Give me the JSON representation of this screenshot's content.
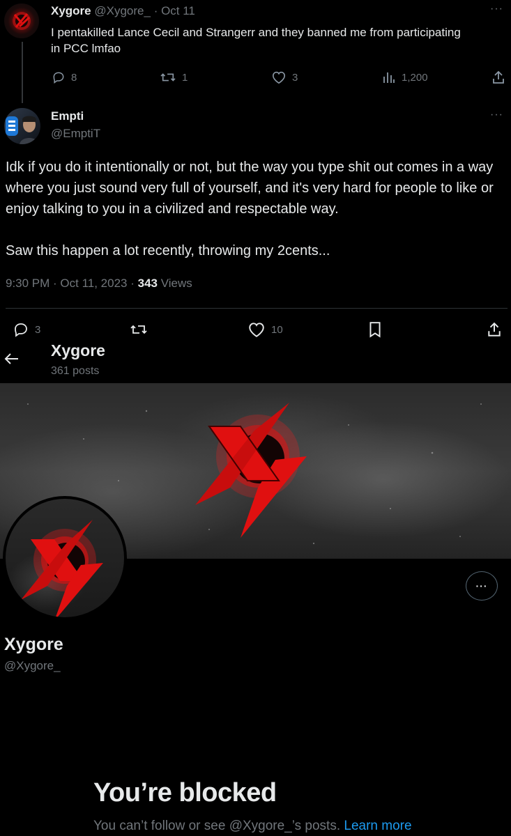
{
  "tweet1": {
    "name": "Xygore",
    "handle": "@Xygore_",
    "time": "· Oct 11",
    "text": "I pentakilled Lance Cecil and Strangerr and they banned me from participating in PCC lmfao",
    "replies": "8",
    "retweets": "1",
    "likes": "3",
    "views": "1,200",
    "more": "···"
  },
  "tweet2": {
    "name": "Empti",
    "handle": "@EmptiT",
    "more": "···",
    "paragraph1": "Idk if you do it intentionally or not, but the way you type shit out comes in a way where you just sound very full of yourself, and it's very hard for people to like or enjoy talking to you in a civilized and respectable way.",
    "paragraph2": "Saw this happen a lot recently, throwing my 2cents...",
    "timestamp": "9:30 PM · Oct 11, 2023 ·",
    "views_count": "343",
    "views_label": "Views",
    "replies": "3",
    "retweets": "",
    "likes": "10"
  },
  "profile": {
    "header_name": "Xygore",
    "posts": "361 posts",
    "name": "Xygore",
    "handle": "@Xygore_",
    "more": "···",
    "blocked_title": "You’re blocked",
    "blocked_text": "You can’t follow or see @Xygore_’s posts.",
    "learn_more": "Learn more"
  },
  "icons": [
    "reply-icon",
    "retweet-icon",
    "like-icon",
    "views-icon",
    "share-icon",
    "bookmark-icon",
    "back-arrow-icon",
    "more-icon"
  ],
  "colors": {
    "background": "#000000",
    "text": "#e7e9ea",
    "muted": "#71767b",
    "link": "#1d9bf0",
    "brand_red": "#e01010"
  }
}
